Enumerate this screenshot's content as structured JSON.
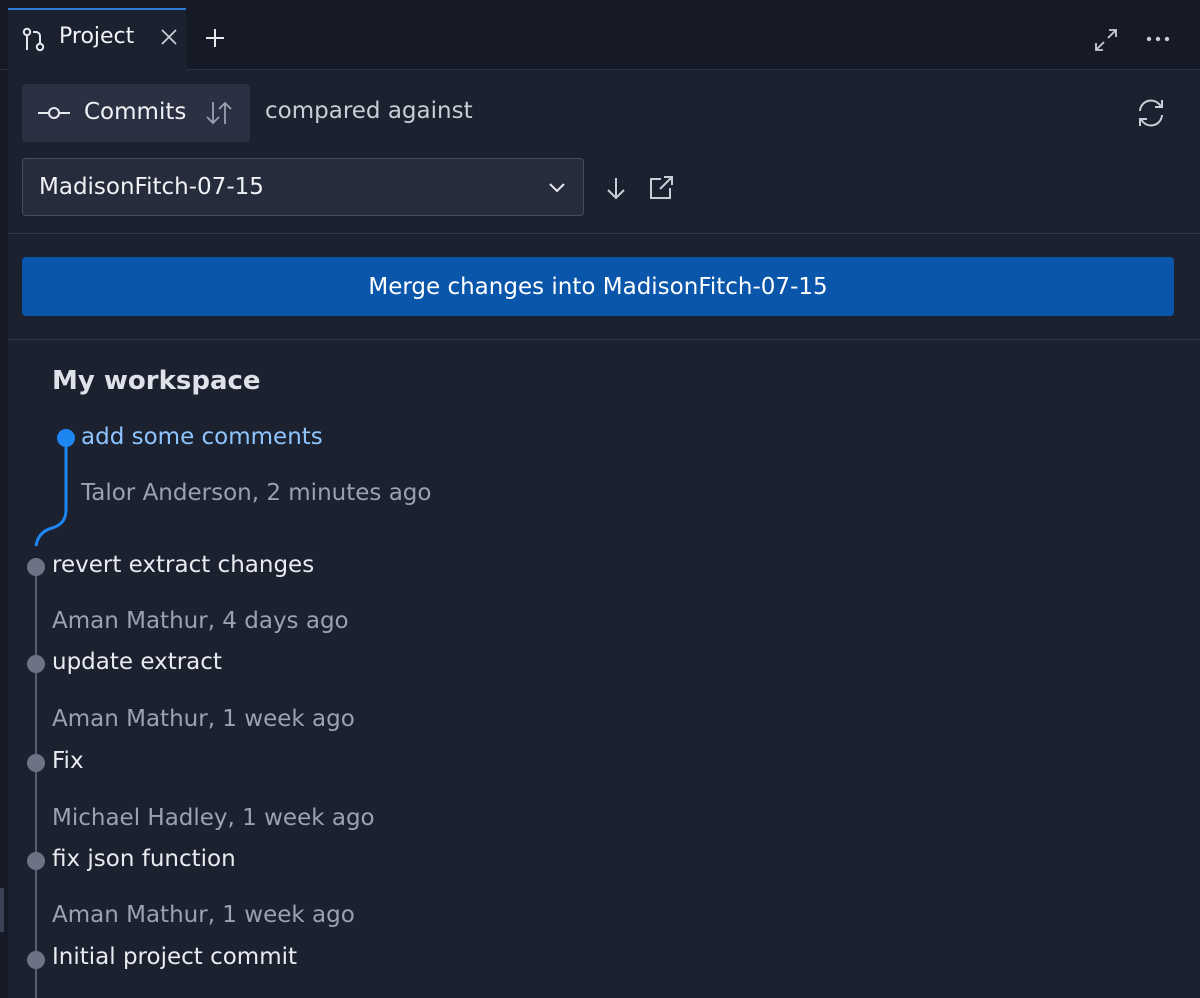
{
  "tab": {
    "label": "Project"
  },
  "toolbar": {
    "commits_label": "Commits",
    "compared_text": "compared against"
  },
  "branch": {
    "selected": "MadisonFitch-07-15"
  },
  "merge": {
    "label": "Merge changes into MadisonFitch-07-15"
  },
  "workspace": {
    "title": "My workspace"
  },
  "commits": [
    {
      "title": "add some comments",
      "meta": "Talor Anderson, 2 minutes ago",
      "active": true
    },
    {
      "title": "revert extract changes",
      "meta": "Aman Mathur, 4 days ago"
    },
    {
      "title": "update extract",
      "meta": "Aman Mathur, 1 week ago"
    },
    {
      "title": "Fix",
      "meta": "Michael Hadley, 1 week ago"
    },
    {
      "title": "fix json function",
      "meta": "Aman Mathur, 1 week ago"
    },
    {
      "title": "Initial project commit"
    }
  ],
  "colors": {
    "accent": "#0a56ab",
    "graph_active": "#1e86f0",
    "graph_node": "#6c7385"
  }
}
